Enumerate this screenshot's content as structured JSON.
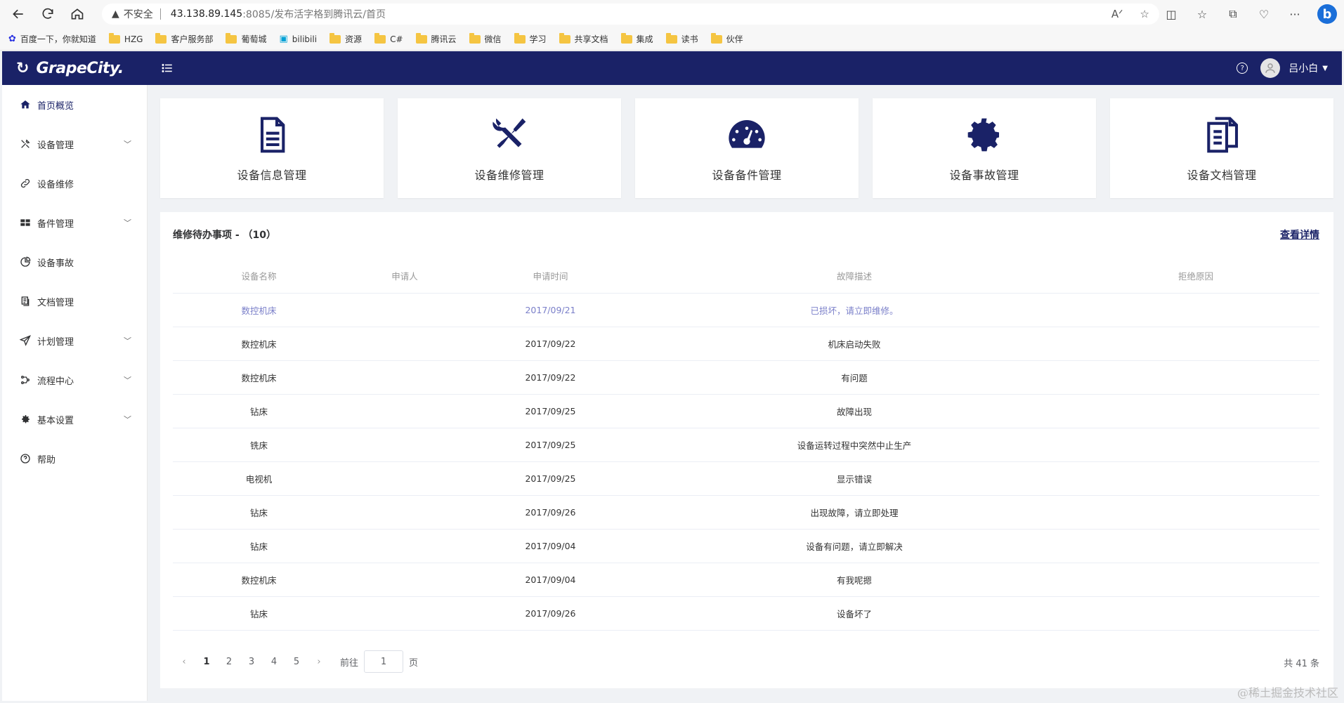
{
  "browser": {
    "address": {
      "security_label": "不安全",
      "url_host": "43.138.89.145",
      "url_rest": ":8085/发布活字格到腾讯云/首页"
    },
    "bookmarks": [
      {
        "label": "百度一下，你就知道",
        "icon": "baidu-icon"
      },
      {
        "label": "HZG",
        "icon": "folder-icon"
      },
      {
        "label": "客户服务部",
        "icon": "folder-icon"
      },
      {
        "label": "葡萄城",
        "icon": "folder-icon"
      },
      {
        "label": "bilibili",
        "icon": "bilibili-icon"
      },
      {
        "label": "资源",
        "icon": "folder-icon"
      },
      {
        "label": "C#",
        "icon": "folder-icon"
      },
      {
        "label": "腾讯云",
        "icon": "folder-icon"
      },
      {
        "label": "微信",
        "icon": "folder-icon"
      },
      {
        "label": "学习",
        "icon": "folder-icon"
      },
      {
        "label": "共享文档",
        "icon": "folder-icon"
      },
      {
        "label": "集成",
        "icon": "folder-icon"
      },
      {
        "label": "读书",
        "icon": "folder-icon"
      },
      {
        "label": "伙伴",
        "icon": "folder-icon"
      }
    ]
  },
  "header": {
    "logo_text": "GrapeCity.",
    "user_name": "吕小白",
    "bg_color": "#1a2267"
  },
  "sidebar": {
    "items": [
      {
        "label": "首页概览",
        "icon": "home-icon",
        "has_children": false,
        "active": true
      },
      {
        "label": "设备管理",
        "icon": "tools-icon",
        "has_children": true
      },
      {
        "label": "设备维修",
        "icon": "link-icon",
        "has_children": false
      },
      {
        "label": "备件管理",
        "icon": "parts-icon",
        "has_children": true
      },
      {
        "label": "设备事故",
        "icon": "pie-icon",
        "has_children": false
      },
      {
        "label": "文档管理",
        "icon": "doc-icon",
        "has_children": false
      },
      {
        "label": "计划管理",
        "icon": "send-icon",
        "has_children": true
      },
      {
        "label": "流程中心",
        "icon": "flow-icon",
        "has_children": true
      },
      {
        "label": "基本设置",
        "icon": "gear-icon",
        "has_children": true
      },
      {
        "label": "帮助",
        "icon": "help-icon",
        "has_children": false
      }
    ]
  },
  "cards": [
    {
      "label": "设备信息管理",
      "icon": "document-icon"
    },
    {
      "label": "设备维修管理",
      "icon": "wrench-screwdriver-icon"
    },
    {
      "label": "设备备件管理",
      "icon": "gauge-icon"
    },
    {
      "label": "设备事故管理",
      "icon": "gear-icon"
    },
    {
      "label": "设备文档管理",
      "icon": "clipboard-icon"
    }
  ],
  "panel": {
    "title": "维修待办事项 - （10）",
    "link": "查看详情",
    "columns": [
      "设备名称",
      "申请人",
      "申请时间",
      "故障描述",
      "拒绝原因"
    ],
    "rows": [
      [
        "数控机床",
        "",
        "2017/09/21",
        "已损坏，请立即维修。",
        ""
      ],
      [
        "数控机床",
        "",
        "2017/09/22",
        "机床启动失败",
        ""
      ],
      [
        "数控机床",
        "",
        "2017/09/22",
        "有问题",
        ""
      ],
      [
        "钻床",
        "",
        "2017/09/25",
        "故障出现",
        ""
      ],
      [
        "铣床",
        "",
        "2017/09/25",
        "设备运转过程中突然中止生产",
        ""
      ],
      [
        "电视机",
        "",
        "2017/09/25",
        "显示错误",
        ""
      ],
      [
        "钻床",
        "",
        "2017/09/26",
        "出现故障，请立即处理",
        ""
      ],
      [
        "钻床",
        "",
        "2017/09/04",
        "设备有问题，请立即解决",
        ""
      ],
      [
        "数控机床",
        "",
        "2017/09/04",
        "有我呢摁",
        ""
      ],
      [
        "钻床",
        "",
        "2017/09/26",
        "设备坏了",
        ""
      ]
    ]
  },
  "pagination": {
    "pages": [
      "1",
      "2",
      "3",
      "4",
      "5"
    ],
    "current": "1",
    "goto_label": "前往",
    "goto_value": "1",
    "page_suffix": "页",
    "total": "共 41 条"
  },
  "watermark": "@稀土掘金技术社区"
}
